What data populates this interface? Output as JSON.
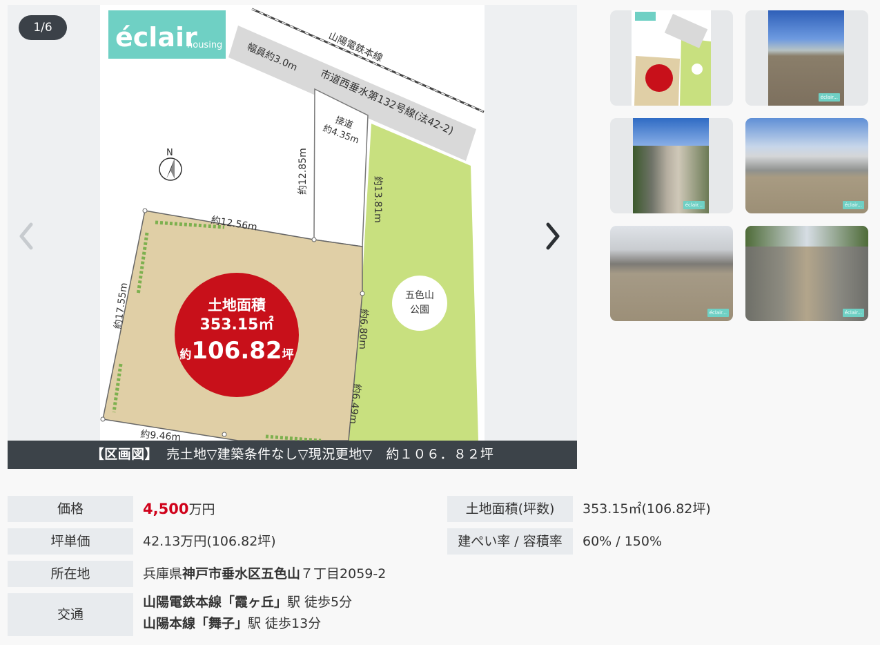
{
  "gallery": {
    "counter": "1/6",
    "caption_tag": "【区画図】",
    "caption_text": "売土地▽建築条件なし▽現況更地▽　約１０６．８２坪",
    "accent_color": "#6fd0c4",
    "plan": {
      "logo_main": "éclair",
      "logo_sub": "housing",
      "railway": "山陽電鉄本線",
      "road_width": "幅員約3.0m",
      "road_name": "市道西垂水第132号線(法42-2)",
      "access_label": "接道",
      "access_width": "約4.35m",
      "dim_lane_left": "約12.85m",
      "dim_lane_right": "約13.81m",
      "dim_top": "約12.56m",
      "dim_left": "約17.55m",
      "dim_right1": "約6.80m",
      "dim_right2": "約6.49m",
      "dim_bottom": "約9.46m",
      "north": "N",
      "park_line1": "五色山",
      "park_line2": "公園",
      "area_title": "土地面積",
      "area_sqm": "353.15㎡",
      "area_prefix": "約",
      "area_tsubo": "106.82",
      "area_unit": "坪"
    }
  },
  "thumbnails": [
    {
      "alt": "plot-plan",
      "watermark": "éclair..."
    },
    {
      "alt": "lot-photo-1",
      "watermark": "éclair..."
    },
    {
      "alt": "lot-photo-2",
      "watermark": "éclair..."
    },
    {
      "alt": "lot-photo-3",
      "watermark": "éclair..."
    },
    {
      "alt": "lot-photo-4",
      "watermark": "éclair..."
    },
    {
      "alt": "lot-photo-5",
      "watermark": "éclair..."
    }
  ],
  "specs": {
    "price_label": "価格",
    "price_number": "4,500",
    "price_unit": "万円",
    "unit_price_label": "坪単価",
    "unit_price_value": "42.13万円(106.82坪)",
    "address_label": "所在地",
    "address_pref": "兵庫県",
    "address_city": "神戸市垂水区五色山",
    "address_rest": "７丁目2059-2",
    "transport_label": "交通",
    "transport_1_line": "山陽電鉄本線「霞ヶ丘」",
    "transport_1_rest": "駅 徒歩5分",
    "transport_2_line": "山陽本線「舞子」",
    "transport_2_rest": "駅 徒歩13分",
    "land_area_label": "土地面積(坪数)",
    "land_area_value": "353.15㎡(106.82坪)",
    "coverage_label": "建ぺい率 / 容積率",
    "coverage_value": "60% / 150%"
  }
}
